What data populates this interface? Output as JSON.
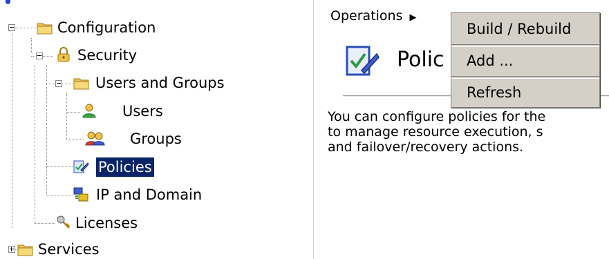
{
  "tree": {
    "items": [
      {
        "label": "Configuration",
        "icon": "folder-icon"
      },
      {
        "label": "Security",
        "icon": "lock-icon"
      },
      {
        "label": "Users and Groups",
        "icon": "folder-icon"
      },
      {
        "label": "Users",
        "icon": "user-icon"
      },
      {
        "label": "Groups",
        "icon": "group-icon"
      },
      {
        "label": "Policies",
        "icon": "policy-icon",
        "selected": true
      },
      {
        "label": "IP and Domain",
        "icon": "network-icon"
      },
      {
        "label": "Licenses",
        "icon": "key-icon"
      },
      {
        "label": "Services",
        "icon": "folder-icon"
      }
    ]
  },
  "main": {
    "breadcrumb": "Operations",
    "breadcrumb_arrow": "▶",
    "page_title": "Polic",
    "description_lines": [
      "You can configure policies for the",
      "to manage resource execution, s",
      "and failover/recovery actions."
    ]
  },
  "context_menu": {
    "items": [
      "Build / Rebuild",
      "Add ...",
      "Refresh"
    ]
  },
  "colors": {
    "selection_bg": "#0a246a",
    "menu_bg": "#d4d0c8",
    "folder": "#f2c14e"
  }
}
